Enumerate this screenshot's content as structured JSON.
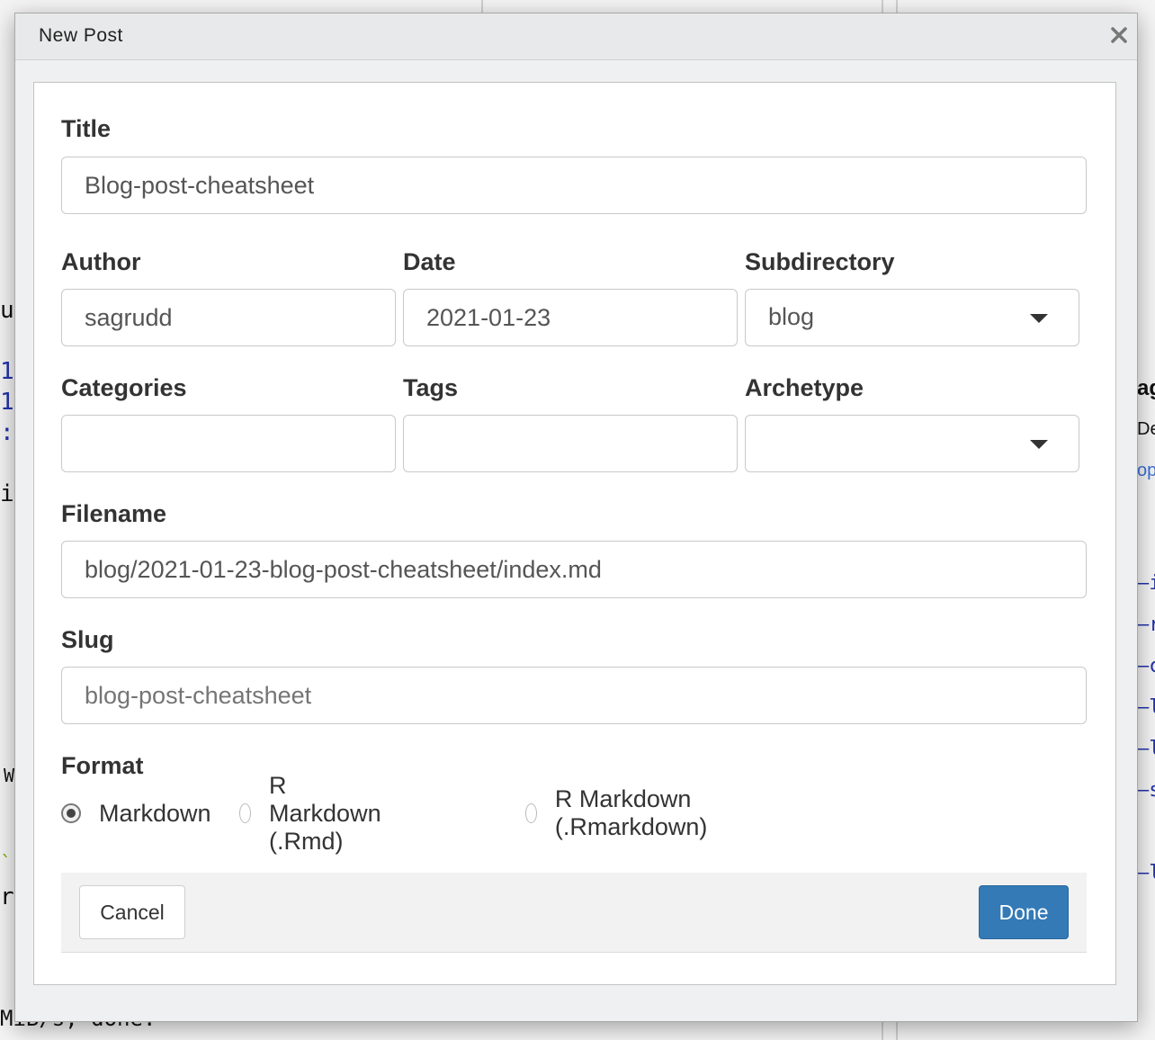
{
  "dialog": {
    "title": "New Post",
    "close_icon": "close-icon"
  },
  "form": {
    "title": {
      "label": "Title",
      "value": "Blog-post-cheatsheet"
    },
    "author": {
      "label": "Author",
      "value": "sagrudd"
    },
    "date": {
      "label": "Date",
      "value": "2021-01-23"
    },
    "subdirectory": {
      "label": "Subdirectory",
      "value": "blog"
    },
    "categories": {
      "label": "Categories",
      "value": ""
    },
    "tags": {
      "label": "Tags",
      "value": ""
    },
    "archetype": {
      "label": "Archetype",
      "value": ""
    },
    "filename": {
      "label": "Filename",
      "value": "blog/2021-01-23-blog-post-cheatsheet/index.md"
    },
    "slug": {
      "label": "Slug",
      "placeholder": "blog-post-cheatsheet"
    },
    "format": {
      "label": "Format",
      "options": [
        "Markdown",
        "R Markdown (.Rmd)",
        "R Markdown (.Rmarkdown)"
      ],
      "selected": "Markdown"
    }
  },
  "buttons": {
    "cancel": "Cancel",
    "done": "Done"
  },
  "background": {
    "left_fragments": [
      "u",
      "1",
      "1",
      ":",
      "i",
      "W",
      "`r",
      "ru",
      "MiB/s, done."
    ],
    "right_fragments": [
      "ag",
      "Del",
      "opr",
      "–i",
      "–r",
      "–c",
      "–l",
      "–l",
      "–s",
      "–l"
    ]
  },
  "colors": {
    "accent": "#337ab7",
    "dialog_bg": "#eef0f1"
  }
}
